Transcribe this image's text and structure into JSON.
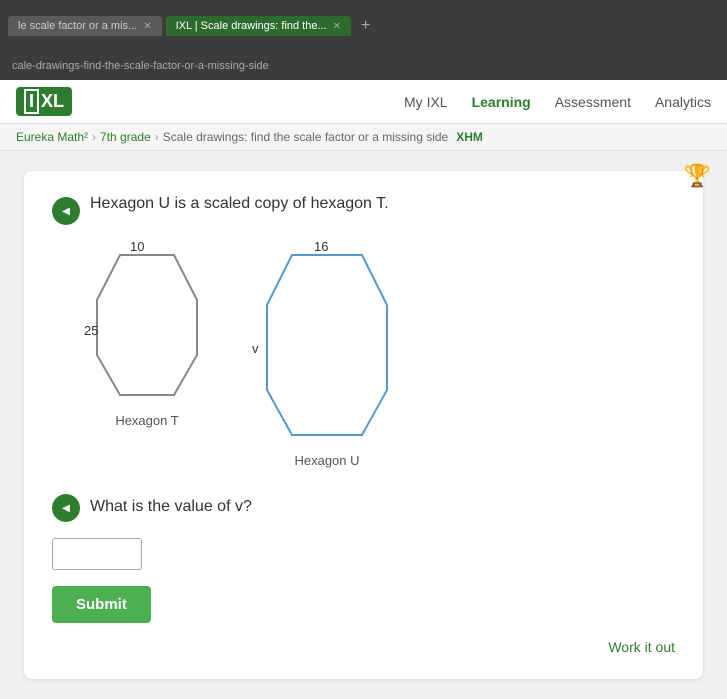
{
  "browser": {
    "tabs": [
      {
        "label": "le scale factor or a mis...",
        "active": false
      },
      {
        "label": "IXL | Scale drawings: find the...",
        "active": true
      }
    ],
    "tab_add_label": "+",
    "address_bar": "cale-drawings-find-the-scale-factor-or-a-missing-side"
  },
  "nav": {
    "logo_text": "IXL",
    "links": [
      {
        "label": "My IXL",
        "active": false
      },
      {
        "label": "Learning",
        "active": true
      },
      {
        "label": "Assessment",
        "active": false
      },
      {
        "label": "Analytics",
        "active": false
      }
    ]
  },
  "breadcrumb": {
    "parts": [
      {
        "text": "Eureka Math²"
      },
      {
        "text": "7th grade"
      },
      {
        "text": "Scale drawings: find the scale factor or a missing side"
      }
    ],
    "skill_code": "XHM"
  },
  "question1": {
    "text": "Hexagon U is a scaled copy of hexagon T.",
    "hexagon_t": {
      "label": "Hexagon T",
      "side_top": "10",
      "side_left": "25"
    },
    "hexagon_u": {
      "label": "Hexagon U",
      "side_top": "16",
      "side_left": "v"
    }
  },
  "question2": {
    "text": "What is the value of v?",
    "input_placeholder": "",
    "submit_label": "Submit"
  },
  "work_it_out": {
    "label": "Work it out"
  }
}
